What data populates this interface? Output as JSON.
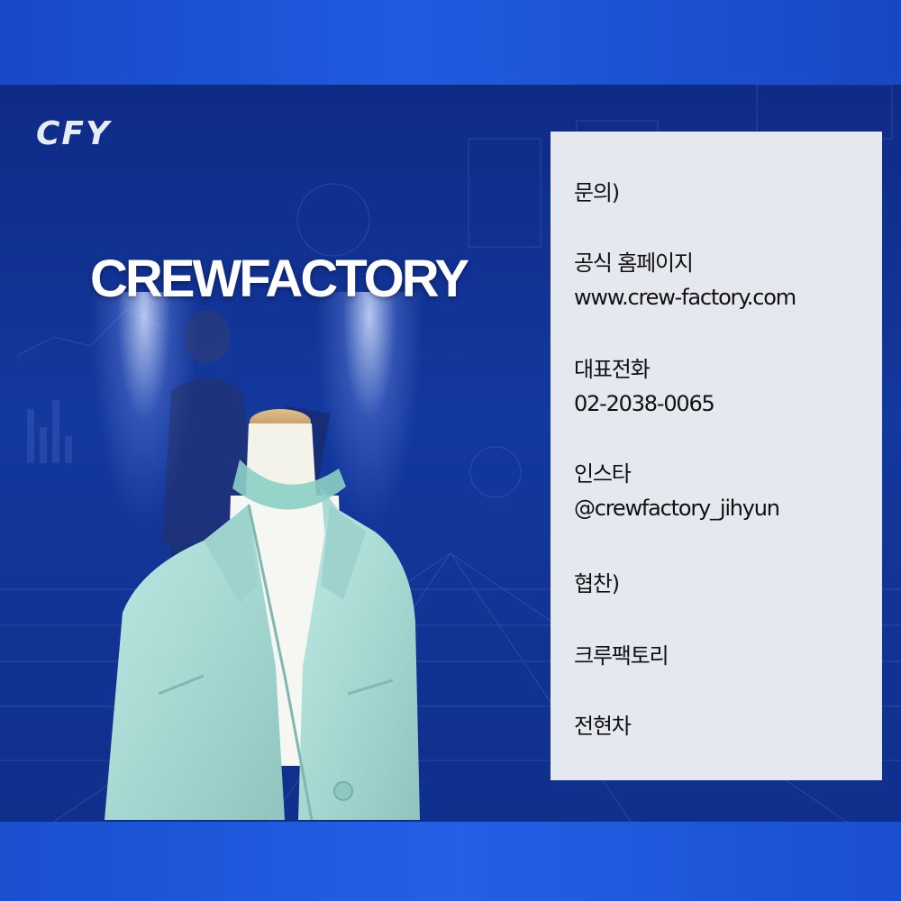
{
  "logo": {
    "text": "CFY"
  },
  "brand": {
    "title": "CREWFACTORY"
  },
  "info": {
    "inquiry_label": "문의)",
    "homepage_label": "공식 홈페이지",
    "homepage_url": "www.crew-factory.com",
    "phone_label": "대표전화",
    "phone_number": "02-2038-0065",
    "instagram_label": "인스타",
    "instagram_handle": "@crewfactory_jihyun",
    "sponsor_label": "협찬)",
    "sponsor_1": "크루팩토리",
    "sponsor_2": "전현차"
  },
  "colors": {
    "background": "#123a9a",
    "band": "#1f5be0",
    "panel": "#e6e8f0",
    "jacket": "#a9dcd6"
  },
  "icons": [
    "spotlight",
    "mannequin-jacket"
  ]
}
